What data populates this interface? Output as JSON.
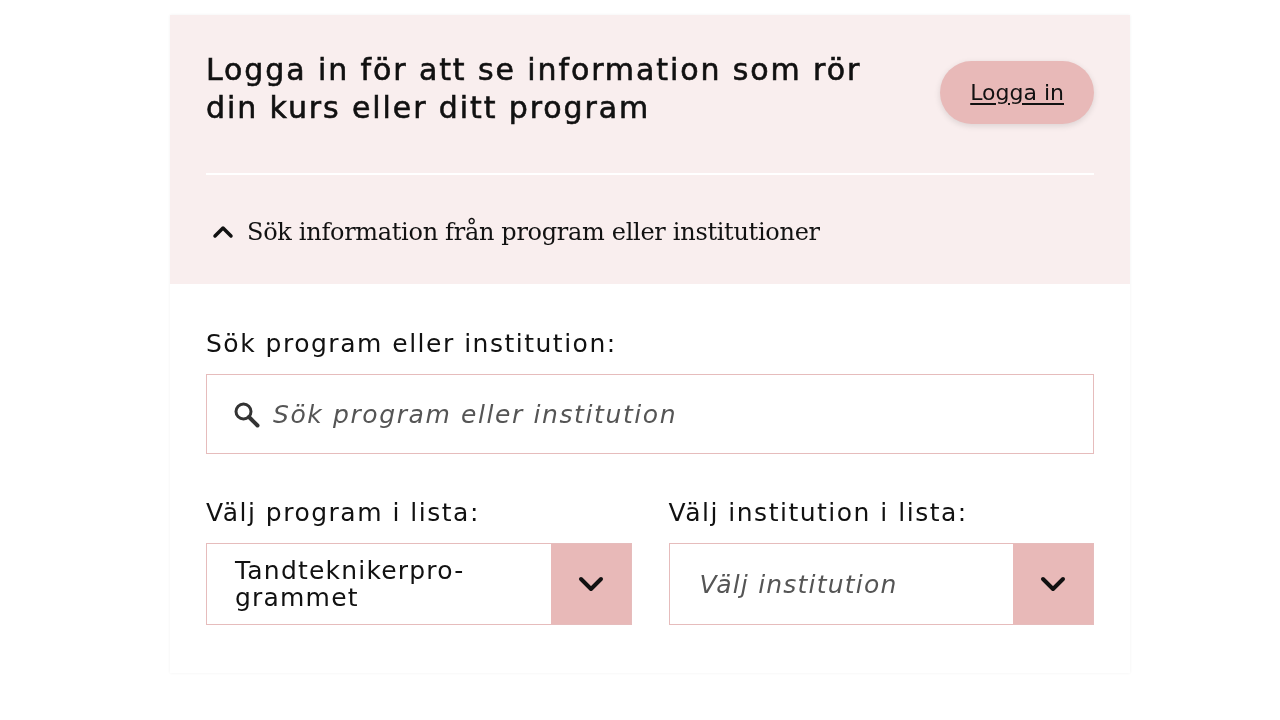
{
  "login_banner": {
    "heading": "Logga in för att se information som rör din kurs eller ditt program",
    "button": "Logga in"
  },
  "search_toggle": {
    "label": "Sök information från program eller institutioner",
    "expanded": true
  },
  "search": {
    "label": "Sök program eller institution:",
    "placeholder": "Sök program eller institution"
  },
  "selects": [
    {
      "label": "Välj program i lista:",
      "value": "Tandteknikerpro-grammet"
    },
    {
      "label": "Välj institution i lista:",
      "placeholder": "Välj institution"
    }
  ]
}
